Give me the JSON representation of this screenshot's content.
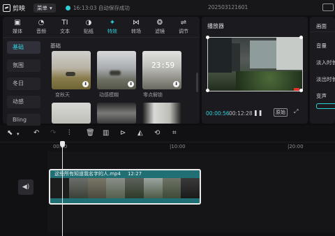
{
  "app": {
    "name": "剪映",
    "menu_label": "菜单",
    "save_status": "16:13:03 自动保存成功",
    "project_name": "202503121601"
  },
  "toolbar": {
    "tools": [
      {
        "label": "媒体",
        "icon": "media-icon",
        "glyph": "▣"
      },
      {
        "label": "音频",
        "icon": "audio-icon",
        "glyph": "◔"
      },
      {
        "label": "文本",
        "icon": "text-icon",
        "glyph": "TI"
      },
      {
        "label": "贴纸",
        "icon": "sticker-icon",
        "glyph": "◑"
      },
      {
        "label": "特效",
        "icon": "effects-icon",
        "glyph": "✦"
      },
      {
        "label": "转场",
        "icon": "transition-icon",
        "glyph": "⋈"
      },
      {
        "label": "滤镜",
        "icon": "filter-icon",
        "glyph": "❂"
      },
      {
        "label": "调节",
        "icon": "adjust-icon",
        "glyph": "⇌"
      }
    ],
    "active_index": 4
  },
  "effects": {
    "categories": [
      "基础",
      "氛围",
      "冬日",
      "动感",
      "Bling"
    ],
    "active_category": 0,
    "section_title": "基础",
    "items": [
      {
        "label": "变秋天"
      },
      {
        "label": "动感模糊"
      },
      {
        "label": "零点解锁",
        "overlay_text": "23:59"
      },
      {
        "label": ""
      },
      {
        "label": ""
      },
      {
        "label": ""
      }
    ]
  },
  "player": {
    "title": "播放器",
    "current_time": "00:00:56",
    "total_time": "00:12:28",
    "original_label": "原始"
  },
  "properties": {
    "tab": "画面",
    "labels": [
      "音量",
      "淡入时长",
      "淡出时长",
      "变声"
    ]
  },
  "timeline": {
    "ruler_labels": [
      "00:00",
      "|10:00",
      "|20:00"
    ],
    "clip": {
      "name": "这些所有知道我名字的人.mp4",
      "duration": "12:27"
    }
  },
  "colors": {
    "accent": "#2fd0d8",
    "clip_bg": "#1f6f75",
    "panel": "#1b1b1f"
  }
}
